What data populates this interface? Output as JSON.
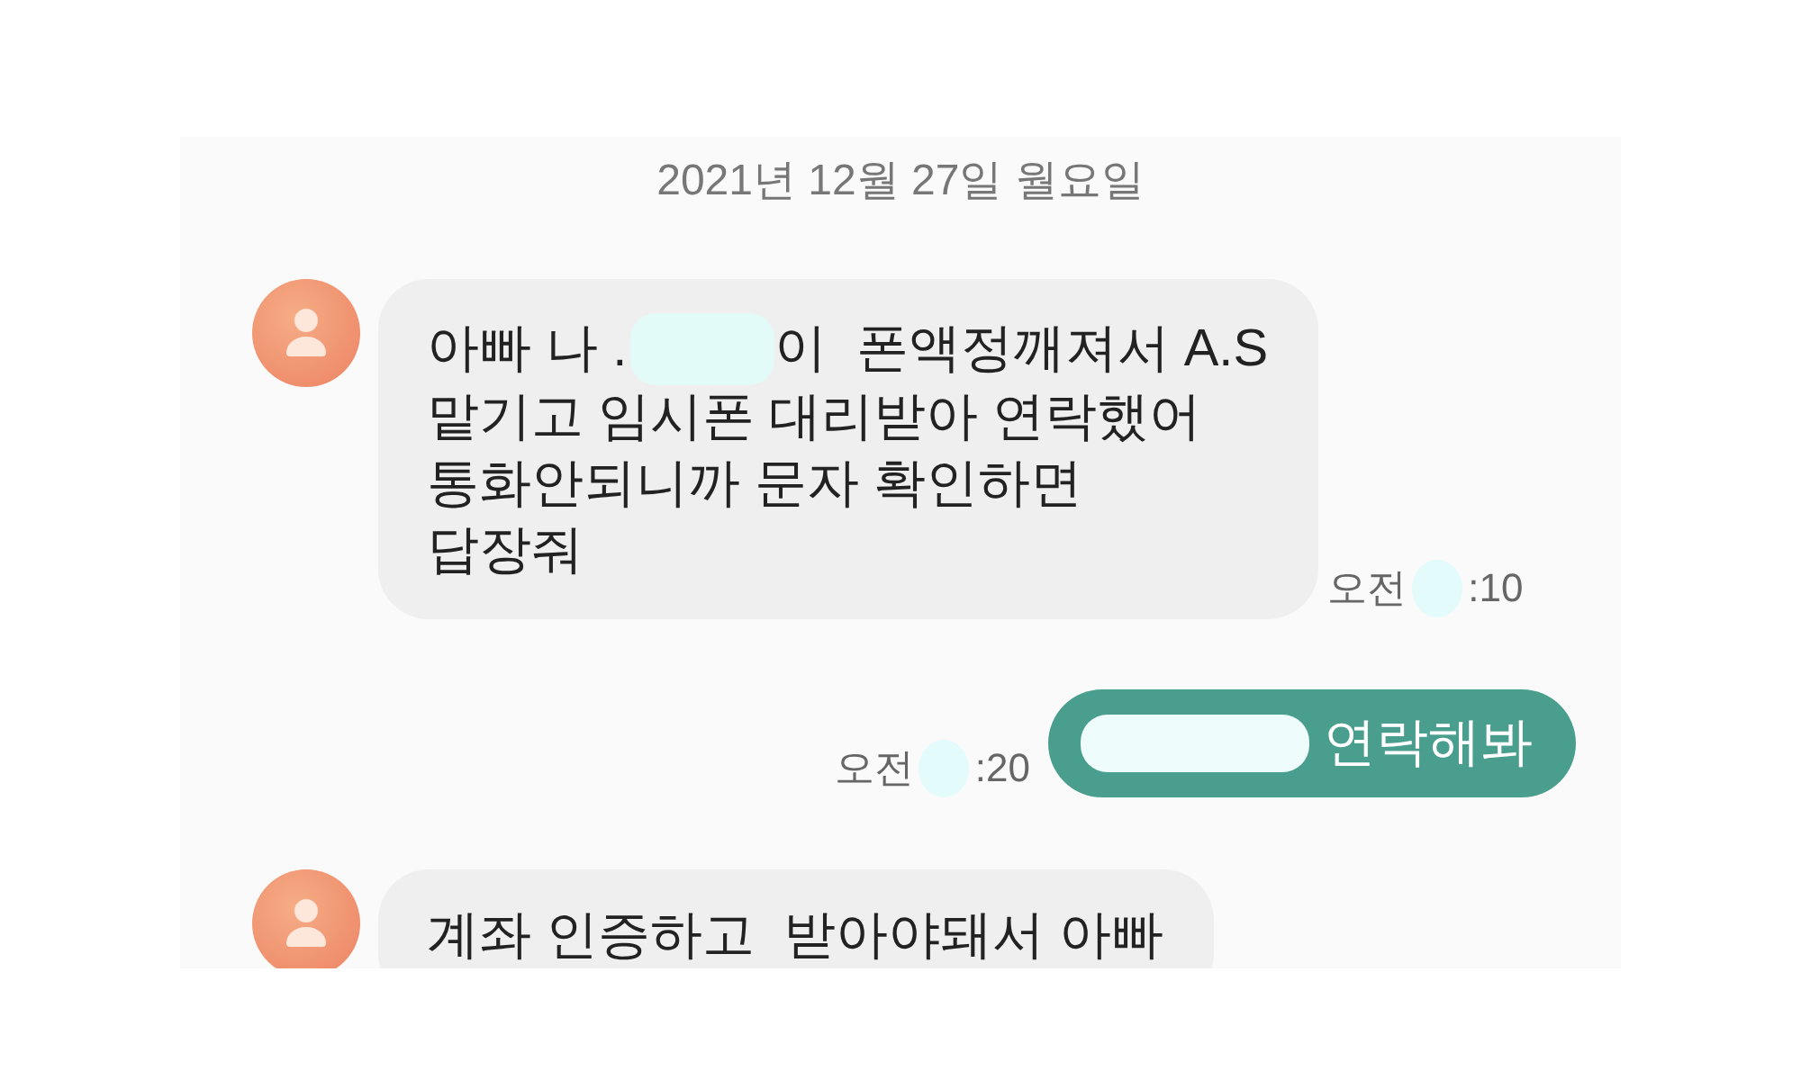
{
  "date_header": "2021년 12월 27일 월요일",
  "messages": [
    {
      "kind": "incoming",
      "lines": [
        [
          {
            "kind": "text",
            "text": "아빠 나 ."
          },
          {
            "kind": "redaction"
          },
          {
            "kind": "text",
            "text": "이  폰액정깨져서 A.S"
          }
        ],
        [
          {
            "kind": "text",
            "text": "맡기고 임시폰 대리받아 연락했어"
          }
        ],
        [
          {
            "kind": "text",
            "text": "통화안되니까 문자 확인하면"
          }
        ],
        [
          {
            "kind": "text",
            "text": "답장줘"
          }
        ]
      ],
      "time": [
        {
          "kind": "text",
          "text": "오전"
        },
        {
          "kind": "redaction"
        },
        {
          "kind": "text",
          "text": ":10"
        }
      ]
    },
    {
      "kind": "outgoing",
      "lines": [
        [
          {
            "kind": "redaction"
          },
          {
            "kind": "text",
            "text": "연락해봐"
          }
        ]
      ],
      "time": [
        {
          "kind": "text",
          "text": "오전"
        },
        {
          "kind": "redaction"
        },
        {
          "kind": "text",
          "text": ":20"
        }
      ]
    },
    {
      "kind": "incoming",
      "lines": [
        [
          {
            "kind": "text",
            "text": "계좌 인증하고  받아야돼서 아빠"
          }
        ]
      ]
    }
  ]
}
